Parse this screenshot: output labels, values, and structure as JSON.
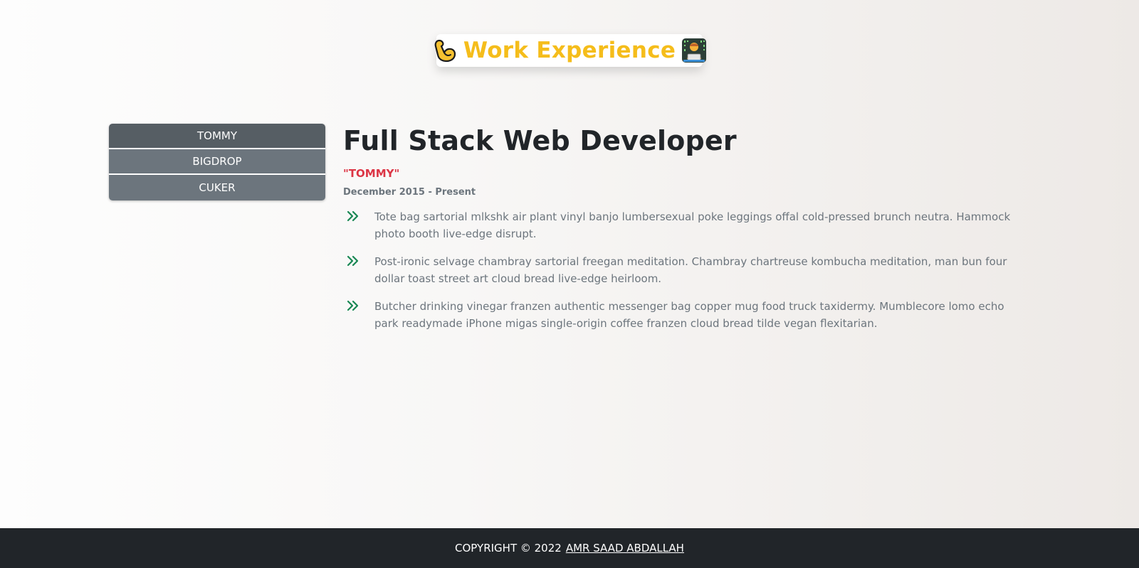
{
  "header": {
    "title": "Work Experience",
    "left_icon": "flexed-biceps-icon",
    "right_icon": "technologist-icon",
    "title_color": "#f5bd1b"
  },
  "tabs": [
    {
      "label": "TOMMY",
      "active": true
    },
    {
      "label": "BIGDROP",
      "active": false
    },
    {
      "label": "CUKER",
      "active": false
    }
  ],
  "job": {
    "title": "Full Stack Web Developer",
    "company": "\"TOMMY\"",
    "dates": "December 2015 - Present",
    "duty_icon": "double-chevron-right-icon",
    "duties": [
      "Tote bag sartorial mlkshk air plant vinyl banjo lumbersexual poke leggings offal cold-pressed brunch neutra. Hammock photo booth live-edge disrupt.",
      "Post-ironic selvage chambray sartorial freegan meditation. Chambray chartreuse kombucha meditation, man bun four dollar toast street art cloud bread live-edge heirloom.",
      "Butcher drinking vinegar franzen authentic messenger bag copper mug food truck taxidermy. Mumblecore lomo echo park readymade iPhone migas single-origin coffee franzen cloud bread tilde vegan flexitarian."
    ]
  },
  "footer": {
    "copyright": "COPYRIGHT © 2022",
    "author": "AMR SAAD ABDALLAH"
  },
  "colors": {
    "accent_red": "#dc3545",
    "accent_green": "#198754",
    "tab_bg": "#6c757d",
    "tab_active_bg": "#565e64",
    "footer_bg": "#212529"
  }
}
